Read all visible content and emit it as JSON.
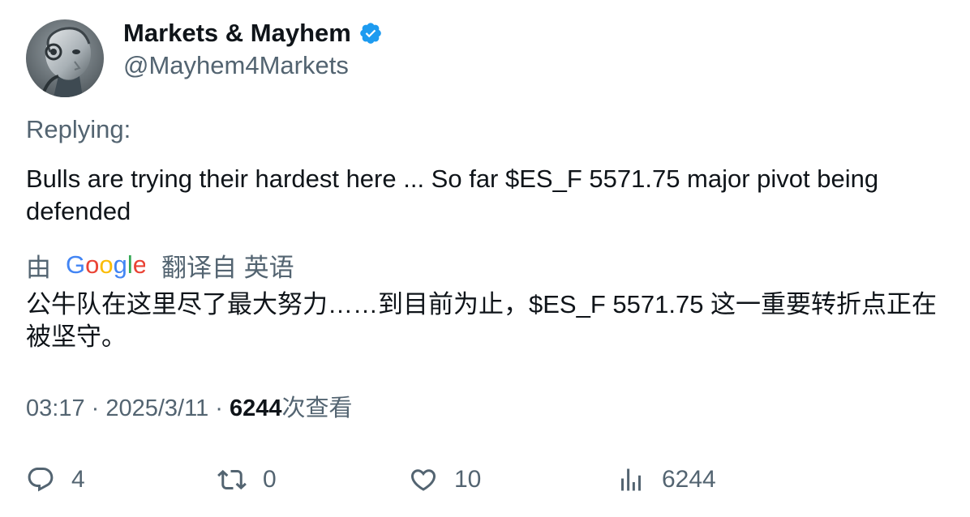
{
  "author": {
    "display_name": "Markets & Mayhem",
    "handle": "@Mayhem4Markets",
    "verified": true,
    "verified_color": "#1d9bf0",
    "avatar_icon": "robot-avatar"
  },
  "reply": {
    "label": "Replying:"
  },
  "tweet": {
    "text": "Bulls are trying their hardest here ... So far $ES_F 5571.75 major pivot being defended"
  },
  "translation": {
    "prefix": "由",
    "provider": "Google",
    "suffix": "翻译自 英语",
    "text": "公牛队在这里尽了最大努力……到目前为止，$ES_F 5571.75 这一重要转折点正在被坚守。"
  },
  "meta": {
    "time": "03:17",
    "separator": "·",
    "date": "2025/3/11",
    "views_count": "6244",
    "views_label": "次查看"
  },
  "actions": {
    "reply_count": "4",
    "retweet_count": "0",
    "like_count": "10",
    "views_count": "6244"
  },
  "colors": {
    "text_primary": "#0f1419",
    "text_secondary": "#536471",
    "accent": "#1d9bf0"
  }
}
